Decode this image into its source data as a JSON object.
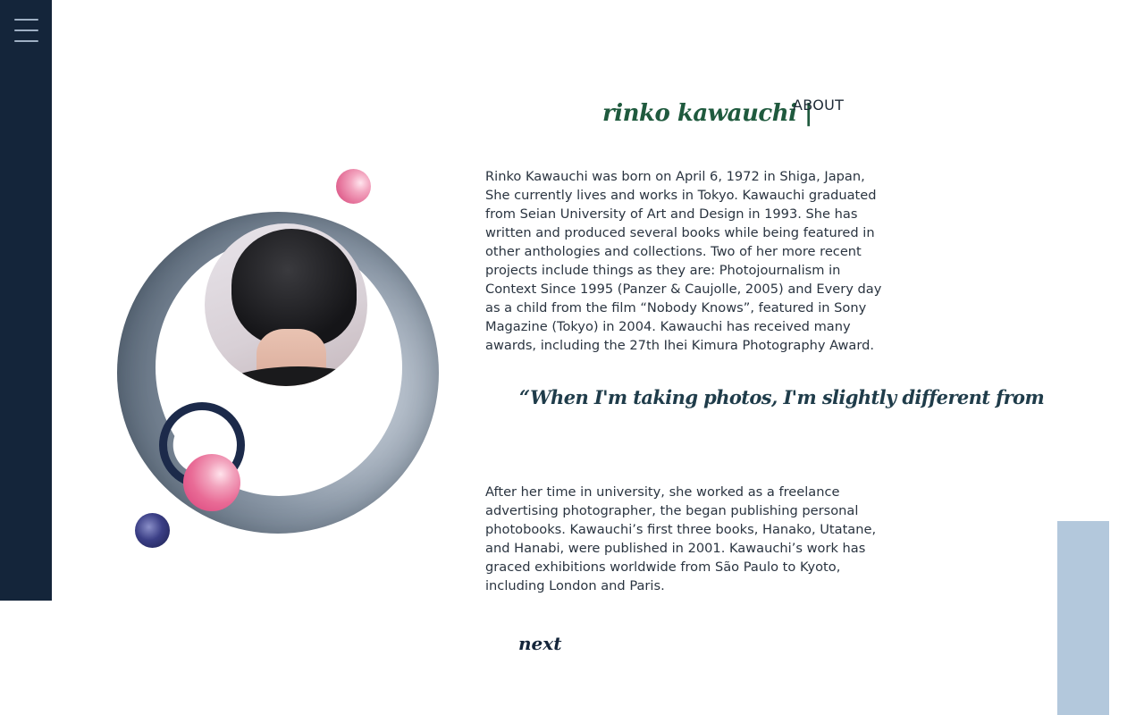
{
  "sidebar": {
    "menu_icon": "hamburger-menu-icon"
  },
  "header": {
    "title": "rinko kawauchi |",
    "nav_label": "ABOUT"
  },
  "bio": {
    "paragraph1": "Rinko Kawauchi was born on April 6, 1972 in Shiga, Japan, She currently lives and works in Tokyo. Kawauchi graduated from Seian University of Art and Design in 1993. She has written and produced several books while being featured in other anthologies and collections. Two of her more recent projects include things as they are: Photojournalism in Context Since 1995 (Panzer & Caujolle, 2005) and Every day as a child from the film “Nobody Knows”, featured in Sony Magazine (Tokyo) in 2004. Kawauchi has received many awards, including the 27th Ihei Kimura Photography Award.",
    "quote": "“When I'm taking photos, I'm slightly different from",
    "paragraph2": "After her time in university, she worked as a freelance advertising photographer, the began publishing personal photobooks. Kawauchi’s first three books, Hanako, Utatane, and Hanabi, were published in 2001. Kawauchi’s work has graced exhibitions worldwide from São Paulo to Kyoto, including London and Paris."
  },
  "footer": {
    "next_label": "next"
  },
  "colors": {
    "sidebar": "#14253a",
    "title_green": "#1f5a3e",
    "accent_blue": "#b3c8dc",
    "pink": "#e96b96"
  }
}
